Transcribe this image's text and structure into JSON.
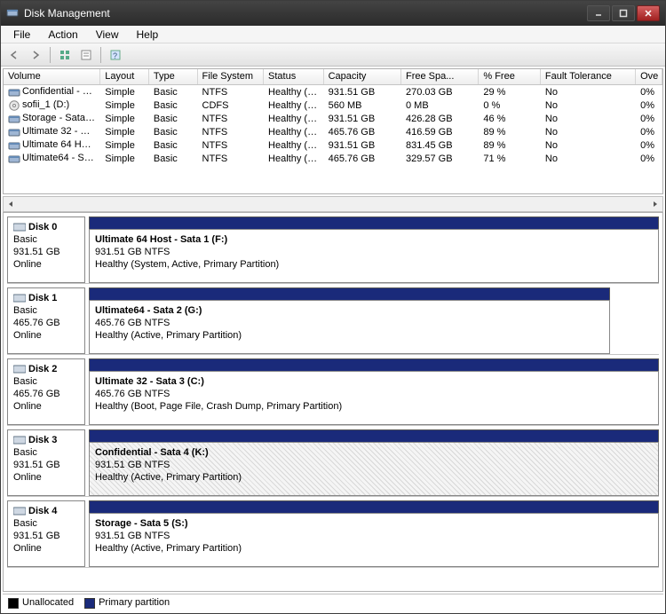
{
  "window": {
    "title": "Disk Management"
  },
  "menu": {
    "file": "File",
    "action": "Action",
    "view": "View",
    "help": "Help"
  },
  "columns": {
    "volume": "Volume",
    "layout": "Layout",
    "type": "Type",
    "fs": "File System",
    "status": "Status",
    "capacity": "Capacity",
    "free": "Free Spa...",
    "pct": "% Free",
    "ft": "Fault Tolerance",
    "ov": "Ove"
  },
  "volumes": [
    {
      "name": "Confidential - Sata...",
      "layout": "Simple",
      "type": "Basic",
      "fs": "NTFS",
      "status": "Healthy (A...",
      "cap": "931.51 GB",
      "free": "270.03 GB",
      "pct": "29 %",
      "ft": "No",
      "ov": "0%"
    },
    {
      "name": "sofii_1 (D:)",
      "layout": "Simple",
      "type": "Basic",
      "fs": "CDFS",
      "status": "Healthy (P...",
      "cap": "560 MB",
      "free": "0 MB",
      "pct": "0 %",
      "ft": "No",
      "ov": "0%"
    },
    {
      "name": "Storage - Sata 5 (S:)",
      "layout": "Simple",
      "type": "Basic",
      "fs": "NTFS",
      "status": "Healthy (A...",
      "cap": "931.51 GB",
      "free": "426.28 GB",
      "pct": "46 %",
      "ft": "No",
      "ov": "0%"
    },
    {
      "name": "Ultimate 32 - Sata ...",
      "layout": "Simple",
      "type": "Basic",
      "fs": "NTFS",
      "status": "Healthy (B...",
      "cap": "465.76 GB",
      "free": "416.59 GB",
      "pct": "89 %",
      "ft": "No",
      "ov": "0%"
    },
    {
      "name": "Ultimate 64 Host - ...",
      "layout": "Simple",
      "type": "Basic",
      "fs": "NTFS",
      "status": "Healthy (S...",
      "cap": "931.51 GB",
      "free": "831.45 GB",
      "pct": "89 %",
      "ft": "No",
      "ov": "0%"
    },
    {
      "name": "Ultimate64 - Sata ...",
      "layout": "Simple",
      "type": "Basic",
      "fs": "NTFS",
      "status": "Healthy (A...",
      "cap": "465.76 GB",
      "free": "329.57 GB",
      "pct": "71 %",
      "ft": "No",
      "ov": "0%"
    }
  ],
  "disks": [
    {
      "name": "Disk 0",
      "type": "Basic",
      "size": "931.51 GB",
      "state": "Online",
      "part": {
        "title": "Ultimate 64 Host - Sata 1  (F:)",
        "size": "931.51 GB NTFS",
        "status": "Healthy (System, Active, Primary Partition)"
      }
    },
    {
      "name": "Disk 1",
      "type": "Basic",
      "size": "465.76 GB",
      "state": "Online",
      "part": {
        "title": "Ultimate64 - Sata 2  (G:)",
        "size": "465.76 GB NTFS",
        "status": "Healthy (Active, Primary Partition)"
      }
    },
    {
      "name": "Disk 2",
      "type": "Basic",
      "size": "465.76 GB",
      "state": "Online",
      "part": {
        "title": "Ultimate 32 - Sata 3  (C:)",
        "size": "465.76 GB NTFS",
        "status": "Healthy (Boot, Page File, Crash Dump, Primary Partition)"
      }
    },
    {
      "name": "Disk 3",
      "type": "Basic",
      "size": "931.51 GB",
      "state": "Online",
      "part": {
        "title": "Confidential - Sata 4  (K:)",
        "size": "931.51 GB NTFS",
        "status": "Healthy (Active, Primary Partition)"
      },
      "hatched": true
    },
    {
      "name": "Disk 4",
      "type": "Basic",
      "size": "931.51 GB",
      "state": "Online",
      "part": {
        "title": "Storage - Sata 5  (S:)",
        "size": "931.51 GB NTFS",
        "status": "Healthy (Active, Primary Partition)"
      }
    }
  ],
  "legend": {
    "unalloc": "Unallocated",
    "primary": "Primary partition"
  }
}
